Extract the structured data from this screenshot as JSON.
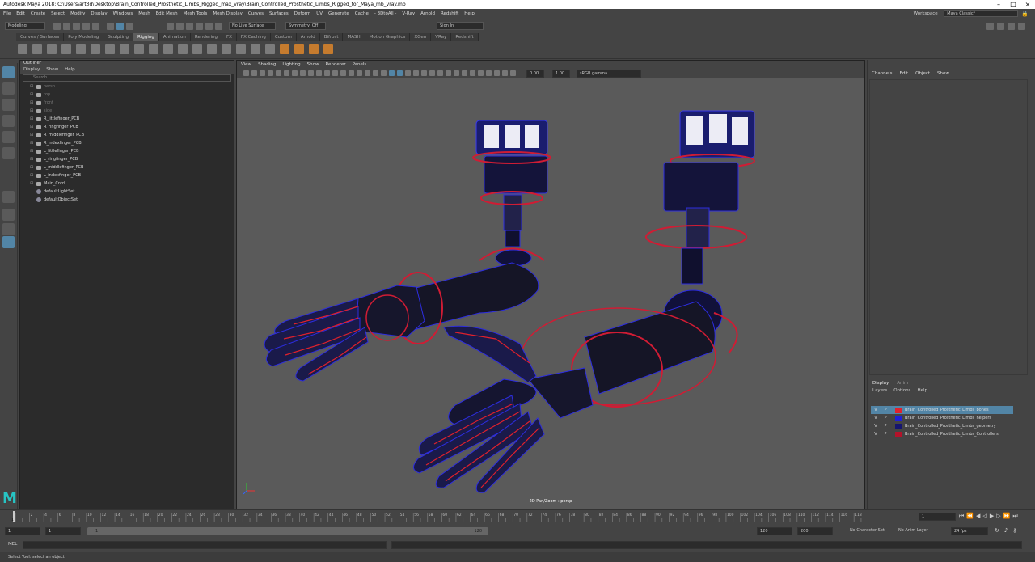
{
  "titlebar": {
    "text": "Autodesk Maya 2018: C:\\Users\\art3d\\Desktop\\Brain_Controlled_Prosthetic_Limbs_Rigged_max_vray\\Brain_Controlled_Prosthetic_Limbs_Rigged_for_Maya_mb_vray.mb"
  },
  "menubar": {
    "items": [
      "File",
      "Edit",
      "Create",
      "Select",
      "Modify",
      "Display",
      "Windows",
      "Mesh",
      "Edit Mesh",
      "Mesh Tools",
      "Mesh Display",
      "Curves",
      "Surfaces",
      "Deform",
      "UV",
      "Generate",
      "Cache",
      "- 3DtoAll -",
      "V-Ray",
      "Arnold",
      "Redshift",
      "Help"
    ]
  },
  "workspace": {
    "label": "Workspace :",
    "value": "Maya Classic*"
  },
  "statusline": {
    "mode": "Modeling",
    "live": "No Live Surface",
    "symmetry": "Symmetry: Off",
    "signin": "Sign In"
  },
  "shelf": {
    "tabs": [
      "Curves / Surfaces",
      "Poly Modeling",
      "Sculpting",
      "Rigging",
      "Animation",
      "Rendering",
      "FX",
      "FX Caching",
      "Custom",
      "Arnold",
      "Bifrost",
      "MASH",
      "Motion Graphics",
      "XGen",
      "VRay",
      "Redshift"
    ],
    "active": "Rigging"
  },
  "outliner": {
    "title": "Outliner",
    "menu": [
      "Display",
      "Show",
      "Help"
    ],
    "search_placeholder": "Search...",
    "items": [
      {
        "label": "persp",
        "dim": true,
        "kind": "cam"
      },
      {
        "label": "top",
        "dim": true,
        "kind": "cam"
      },
      {
        "label": "front",
        "dim": true,
        "kind": "cam"
      },
      {
        "label": "side",
        "dim": true,
        "kind": "cam"
      },
      {
        "label": "R_littlefinger_PCB",
        "dim": false,
        "kind": "node"
      },
      {
        "label": "R_ringfinger_PCB",
        "dim": false,
        "kind": "node"
      },
      {
        "label": "R_middlefinger_PCB",
        "dim": false,
        "kind": "node"
      },
      {
        "label": "R_indexfinger_PCB",
        "dim": false,
        "kind": "node"
      },
      {
        "label": "L_littlefinger_PCB",
        "dim": false,
        "kind": "node"
      },
      {
        "label": "L_ringfinger_PCB",
        "dim": false,
        "kind": "node"
      },
      {
        "label": "L_middlefinger_PCB",
        "dim": false,
        "kind": "node"
      },
      {
        "label": "L_indexfinger_PCB",
        "dim": false,
        "kind": "node"
      },
      {
        "label": "Main_Cntrl",
        "dim": false,
        "kind": "node"
      },
      {
        "label": "defaultLightSet",
        "dim": false,
        "kind": "set"
      },
      {
        "label": "defaultObjectSet",
        "dim": false,
        "kind": "set"
      }
    ]
  },
  "viewport": {
    "menu": [
      "View",
      "Shading",
      "Lighting",
      "Show",
      "Renderer",
      "Panels"
    ],
    "field1": "0.00",
    "field2": "1.00",
    "colorspace": "sRGB gamma",
    "label": "2D Pan/Zoom : persp"
  },
  "channelbox": {
    "menu": [
      "Channels",
      "Edit",
      "Object",
      "Show"
    ]
  },
  "layers": {
    "tabs": [
      "Display",
      "Anim"
    ],
    "menu": [
      "Layers",
      "Options",
      "Help"
    ],
    "rows": [
      {
        "v": "V",
        "p": "P",
        "color": "#e0212c",
        "name": "Brain_Controlled_Prosthetic_Limbs_bones",
        "selected": true
      },
      {
        "v": "V",
        "p": "P",
        "color": "#1f1fd6",
        "name": "Brain_Controlled_Prosthetic_Limbs_helpers",
        "selected": false
      },
      {
        "v": "V",
        "p": "P",
        "color": "#151570",
        "name": "Brain_Controlled_Prosthetic_Limbs_geometry",
        "selected": false
      },
      {
        "v": "V",
        "p": "P",
        "color": "#b3122a",
        "name": "Brain_Controlled_Prosthetic_Limbs_Controllers",
        "selected": false
      }
    ]
  },
  "timeline": {
    "ticks": [
      "2",
      "4",
      "6",
      "8",
      "10",
      "12",
      "14",
      "16",
      "18",
      "20",
      "22",
      "24",
      "26",
      "28",
      "30",
      "32",
      "34",
      "36",
      "38",
      "40",
      "42",
      "44",
      "46",
      "48",
      "50",
      "52",
      "54",
      "56",
      "58",
      "60",
      "62",
      "64",
      "66",
      "68",
      "70",
      "72",
      "74",
      "76",
      "78",
      "80",
      "82",
      "84",
      "86",
      "88",
      "90",
      "92",
      "94",
      "96",
      "98",
      "100",
      "102",
      "104",
      "106",
      "108",
      "110",
      "112",
      "114",
      "116",
      "118",
      "120"
    ],
    "current": "1",
    "start_frame": "1"
  },
  "range": {
    "start": "1",
    "inner_start": "1",
    "slider_start": "1",
    "slider_end": "120",
    "end": "120",
    "anim_end": "200",
    "character": "No Character Set",
    "anim_layer": "No Anim Layer",
    "fps": "24 fps"
  },
  "mel": {
    "label": "MEL"
  },
  "help": {
    "text": "Select Tool: select an object"
  },
  "brand": {
    "logo": "M"
  }
}
